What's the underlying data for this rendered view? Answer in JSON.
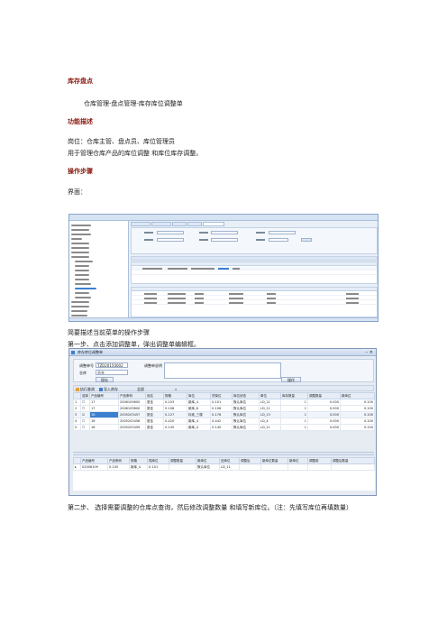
{
  "doc": {
    "title": "库存盘点",
    "nav_path": "仓库管理-盘点管理-库存库位调整单",
    "section_function": "功能描述",
    "roles": "岗位：仓库主管、盘点员、库位管理员",
    "purpose": "用于管理仓库产品的库位调整 和库位库存调整。",
    "section_steps": "操作步骤",
    "ui_label": "界面：",
    "brief": "简要描述当前菜单的操作步骤",
    "step1": "第一步、点击添加调整单，弹出调整单编辑框。",
    "step2": "第二步、 选择需要调整的仓库点查询，然后修改调整数量 和填写新库位。（注：先填写库位再填数量）"
  },
  "dialog": {
    "title": "库存库位调整单",
    "min": "–",
    "close": "✕",
    "label_no": "调整单号",
    "value_no": "TZD20150002",
    "label_wh": "仓库",
    "value_wh": "总仓",
    "label_remark": "调整单说明",
    "btn_save": "保存",
    "btn_ops": "操作",
    "toolbar": {
      "query": "执行查询",
      "import": "导入库存",
      "filter": "全部"
    },
    "grid": {
      "columns": [
        "",
        "选择",
        "产品编号",
        "产品条码",
        "品名",
        "规格",
        "库位",
        "货架位",
        "库位状态",
        "单位",
        "库存数量",
        "调整数量",
        "新库位"
      ],
      "rows": [
        [
          "1",
          "☐",
          "17",
          "2006109600",
          "夏佳",
          "0-103",
          "新库_4",
          "0-101",
          "默认库位",
          "LD_11",
          "1",
          "0.000",
          "0.100"
        ],
        [
          "2",
          "☐",
          "17",
          "2006109600",
          "夏佳",
          "0-108",
          "新库_8",
          "0-106",
          "默认库位",
          "LD_11",
          "1",
          "0.000",
          "0.100"
        ],
        [
          "3",
          "☑",
          "18",
          "2005203457",
          "夏佳",
          "0-127",
          "标准_三楼",
          "0-176",
          "默认库位",
          "LD_13",
          "1",
          "0.000",
          "0.100"
        ],
        [
          "4",
          "☐",
          "18",
          "2005203458",
          "夏佳",
          "0-420",
          "新库_4",
          "0-442",
          "默认库位",
          "LD_4",
          "1",
          "0.000",
          "0.100"
        ],
        [
          "5",
          "☐",
          "18",
          "2005203459",
          "夏佳",
          "0-145",
          "新库_4",
          "0-140",
          "默认库位",
          "LD_11",
          "1",
          "0.000",
          "0.100"
        ]
      ]
    },
    "detail": {
      "columns": [
        "",
        "产品编号",
        "产品条码",
        "规格",
        "现库位",
        "调整数量",
        "新库位",
        "旧库位",
        "调整后",
        "新库位数量",
        "新库位",
        "调整前",
        "调整后数量"
      ],
      "rows": [
        [
          "▸",
          "02006109",
          "0-105",
          "新库_4",
          "0-101",
          "",
          "默认库位",
          "LD_11",
          "",
          "",
          "",
          "",
          ""
        ]
      ]
    }
  },
  "colors": {
    "heading": "#8a1a10",
    "selection": "#3c7fd0",
    "chrome": "#d6e3f3"
  }
}
